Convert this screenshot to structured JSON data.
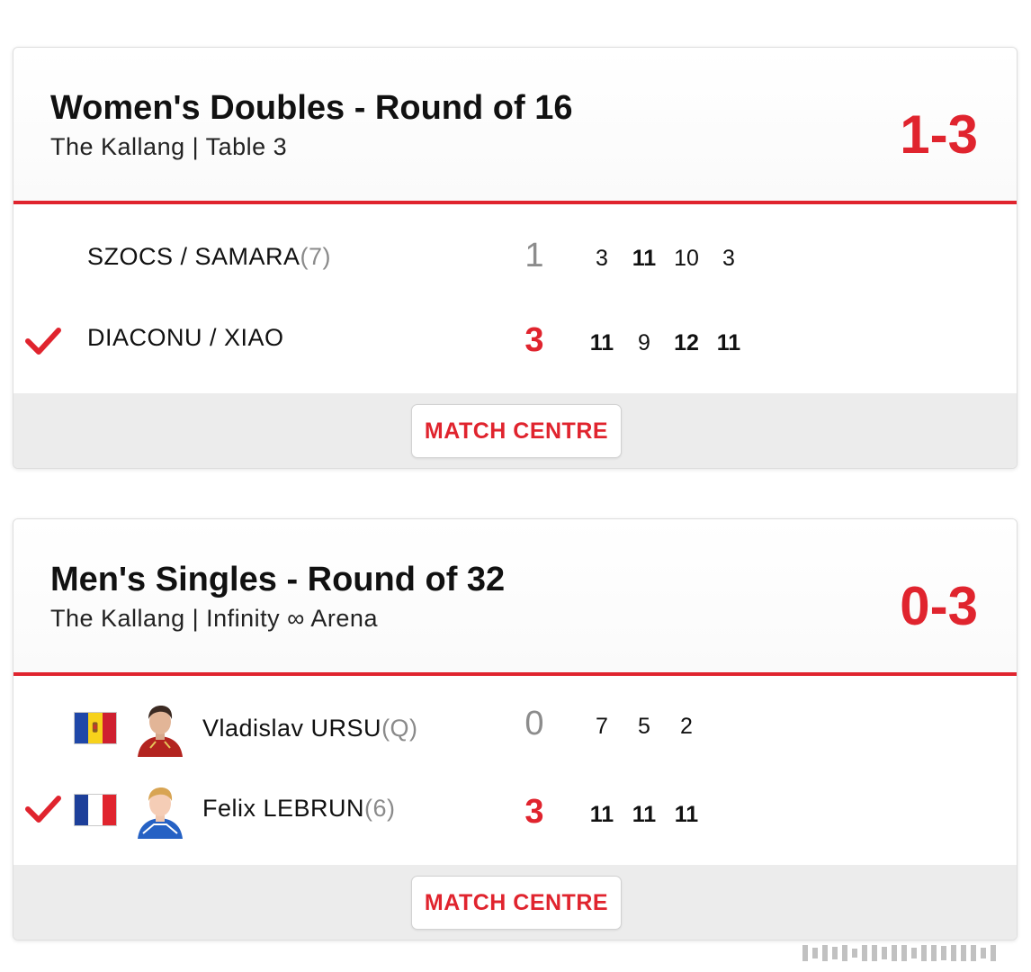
{
  "colors": {
    "accent": "#e0242e",
    "loser_games": "#8c8c8c",
    "seed": "#8a8a8a",
    "footer_bg": "#ececec"
  },
  "matches": [
    {
      "title": "Women's Doubles - Round of 16",
      "venue": "The Kallang | Table 3",
      "overall_score": "1-3",
      "teams": [
        {
          "name": "SZOCS / SAMARA",
          "seed": "(7)",
          "winner": false,
          "games_won": "1",
          "game_scores": [
            "3",
            "11",
            "10",
            "3"
          ]
        },
        {
          "name": "DIACONU / XIAO",
          "seed": "",
          "winner": true,
          "games_won": "3",
          "game_scores": [
            "11",
            "9",
            "12",
            "11"
          ]
        }
      ],
      "match_centre_label": "MATCH CENTRE"
    },
    {
      "title": "Men's Singles - Round of 32",
      "venue": "The Kallang | Infinity ∞ Arena",
      "overall_score": "0-3",
      "players": [
        {
          "name": "Vladislav URSU",
          "seed": "(Q)",
          "flag": "moldova-flag-icon",
          "avatar": "player-photo-ursu",
          "winner": false,
          "games_won": "0",
          "game_scores": [
            "7",
            "5",
            "2"
          ]
        },
        {
          "name": "Felix LEBRUN",
          "seed": "(6)",
          "flag": "france-flag-icon",
          "avatar": "player-photo-lebrun",
          "winner": true,
          "games_won": "3",
          "game_scores": [
            "11",
            "11",
            "11"
          ]
        }
      ],
      "match_centre_label": "MATCH CENTRE"
    }
  ],
  "icons": {
    "winner_mark": "checkmark-icon"
  }
}
